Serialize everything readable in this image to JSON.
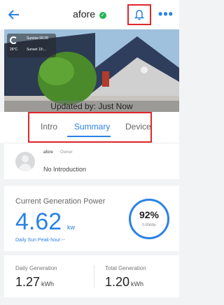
{
  "header": {
    "title": "afore",
    "status": "online",
    "back_icon": "back-arrow-icon",
    "bell_icon": "bell-icon",
    "more_icon": "more-dots-icon"
  },
  "hero": {
    "weather": {
      "sunrise": "Sunrise 06:28",
      "temperature": "26°C",
      "sunset": "Sunset 19:..."
    },
    "updated": "Updated by: Just Now"
  },
  "tabs": [
    {
      "label": "Intro"
    },
    {
      "label": "Summary"
    },
    {
      "label": "Device"
    }
  ],
  "owner": {
    "name": "afore",
    "role": "Owner",
    "intro": "No Introduction"
  },
  "power": {
    "label": "Current Generation Power",
    "value": "4.62",
    "unit": "kw",
    "peak": "Daily Sun Peak-hour:--",
    "percent": "92%",
    "capacity": "5.00kWp"
  },
  "generation": {
    "daily_label": "Daily Generation",
    "daily_value": "1.27",
    "daily_unit": "kWh",
    "total_label": "Total Generation",
    "total_value": "1.20",
    "total_unit": "kWh"
  },
  "colors": {
    "accent": "#2a82e4",
    "highlight": "#e0262d",
    "online": "#26b35a"
  }
}
